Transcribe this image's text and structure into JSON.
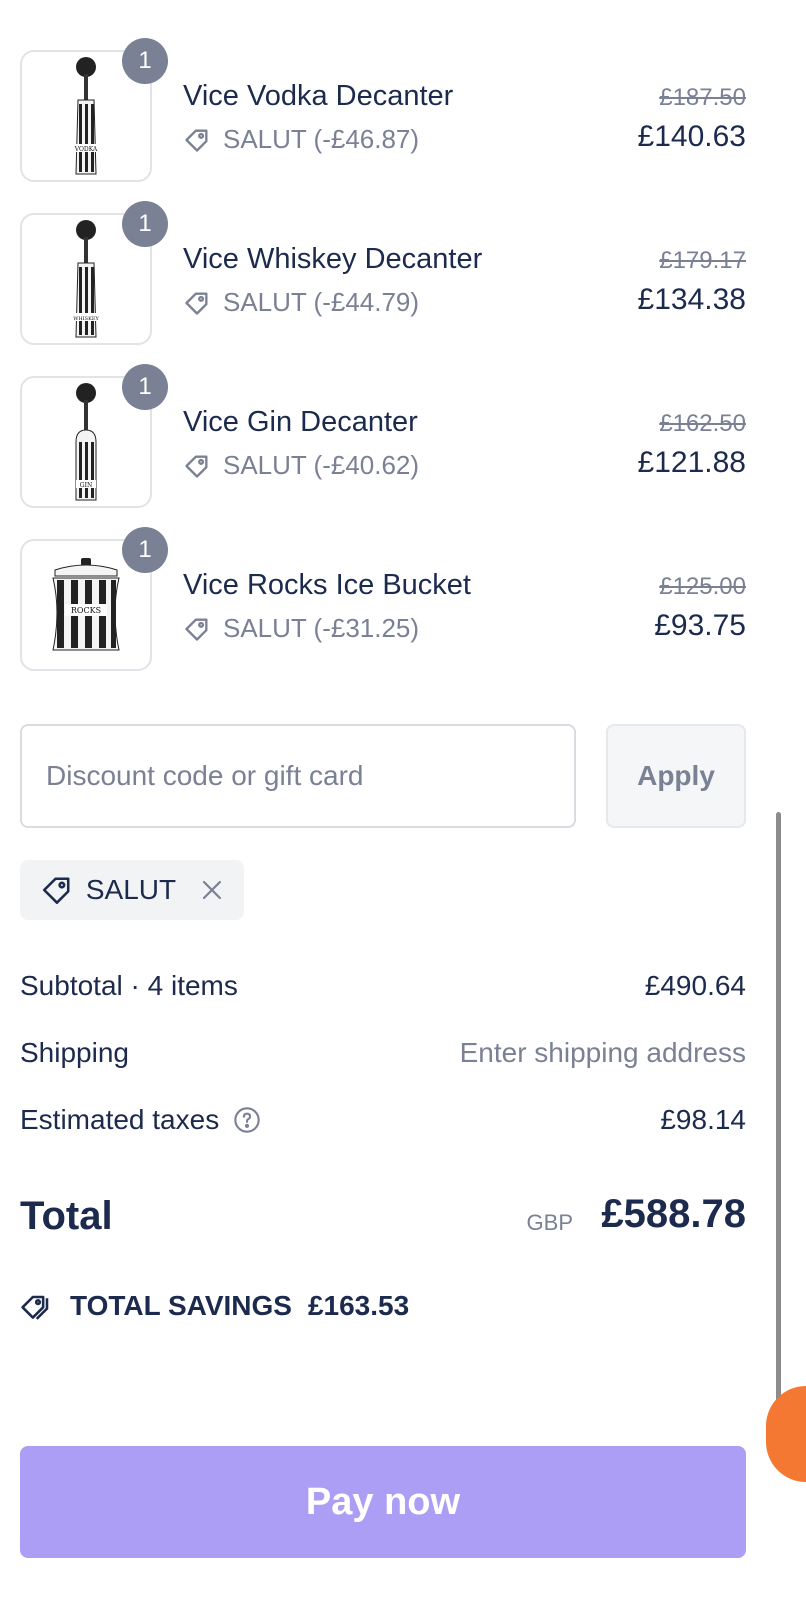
{
  "items": [
    {
      "name": "Vice Vodka Decanter",
      "quantity": "1",
      "discount": "SALUT (-£46.87)",
      "original_price": "£187.50",
      "price": "£140.63",
      "label_text": "VODKA"
    },
    {
      "name": "Vice Whiskey Decanter",
      "quantity": "1",
      "discount": "SALUT (-£44.79)",
      "original_price": "£179.17",
      "price": "£134.38",
      "label_text": "WHISKEY"
    },
    {
      "name": "Vice Gin Decanter",
      "quantity": "1",
      "discount": "SALUT (-£40.62)",
      "original_price": "£162.50",
      "price": "£121.88",
      "label_text": "GIN"
    },
    {
      "name": "Vice Rocks Ice Bucket",
      "quantity": "1",
      "discount": "SALUT (-£31.25)",
      "original_price": "£125.00",
      "price": "£93.75",
      "label_text": "ROCKS"
    }
  ],
  "discount": {
    "placeholder": "Discount code or gift card",
    "apply_label": "Apply",
    "applied_code": "SALUT"
  },
  "summary": {
    "subtotal_label": "Subtotal · 4 items",
    "subtotal_value": "£490.64",
    "shipping_label": "Shipping",
    "shipping_value": "Enter shipping address",
    "taxes_label": "Estimated taxes",
    "taxes_value": "£98.14",
    "total_label": "Total",
    "currency": "GBP",
    "total_value": "£588.78"
  },
  "savings": {
    "label": "TOTAL SAVINGS",
    "value": "£163.53"
  },
  "pay": {
    "label": "Pay now"
  },
  "colors": {
    "text": "#1c2a4d",
    "muted": "#7a8195",
    "pay_button": "#ac9ef4",
    "badge": "#7a8195",
    "chat_bubble": "#f47732"
  }
}
